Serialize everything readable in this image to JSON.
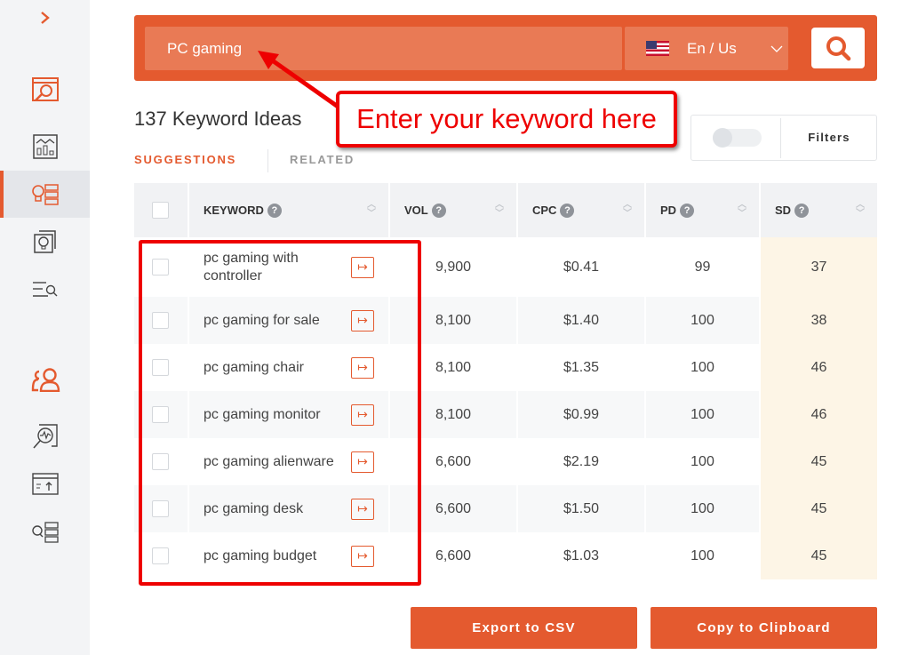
{
  "sidebar": {
    "items": [
      "expand",
      "keyword-overview",
      "analytics",
      "keyword-ideas",
      "content-ideas",
      "serp-search",
      "backlinks-profile",
      "site-audit",
      "rank-tracker",
      "keyword-list"
    ],
    "active": "keyword-ideas"
  },
  "search": {
    "value": "PC gaming",
    "language": "En / Us"
  },
  "results_title": "137 Keyword Ideas",
  "tabs": [
    {
      "label": "SUGGESTIONS",
      "active": true
    },
    {
      "label": "RELATED",
      "active": false
    }
  ],
  "filters_label": "Filters",
  "table": {
    "headers": [
      "KEYWORD",
      "VOL",
      "CPC",
      "PD",
      "SD"
    ],
    "rows": [
      {
        "keyword": "pc gaming with controller",
        "vol": "9,900",
        "cpc": "$0.41",
        "pd": "99",
        "sd": "37"
      },
      {
        "keyword": "pc gaming for sale",
        "vol": "8,100",
        "cpc": "$1.40",
        "pd": "100",
        "sd": "38"
      },
      {
        "keyword": "pc gaming chair",
        "vol": "8,100",
        "cpc": "$1.35",
        "pd": "100",
        "sd": "46"
      },
      {
        "keyword": "pc gaming monitor",
        "vol": "8,100",
        "cpc": "$0.99",
        "pd": "100",
        "sd": "46"
      },
      {
        "keyword": "pc gaming alienware",
        "vol": "6,600",
        "cpc": "$2.19",
        "pd": "100",
        "sd": "45"
      },
      {
        "keyword": "pc gaming desk",
        "vol": "6,600",
        "cpc": "$1.50",
        "pd": "100",
        "sd": "45"
      },
      {
        "keyword": "pc gaming budget",
        "vol": "6,600",
        "cpc": "$1.03",
        "pd": "100",
        "sd": "45"
      }
    ]
  },
  "annotation": "Enter your keyword here",
  "buttons": {
    "export": "Export to CSV",
    "copy": "Copy to Clipboard"
  },
  "colors": {
    "accent": "#e45a2f",
    "annotation": "#ee0000"
  }
}
